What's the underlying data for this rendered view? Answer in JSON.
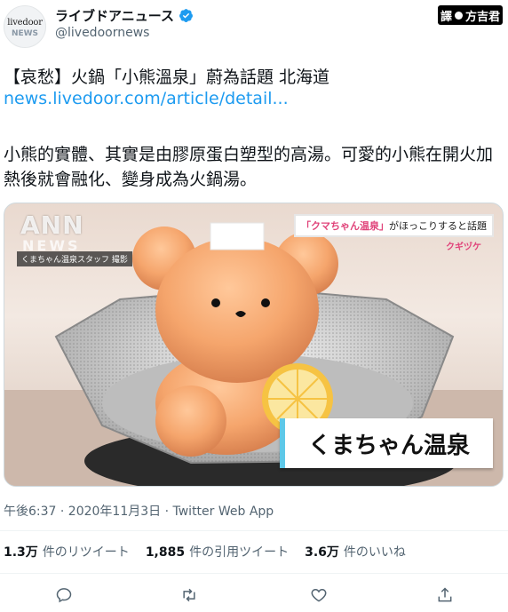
{
  "account": {
    "avatar_line1": "livedoor",
    "avatar_line2": "NEWS",
    "display_name": "ライブドアニュース",
    "handle": "@livedoornews"
  },
  "watermark": {
    "left": "譯",
    "right": "方吉君"
  },
  "tweet": {
    "headline": "【哀愁】火鍋「小熊溫泉」蔚為話題 北海道",
    "link": "news.livedoor.com/article/detail...",
    "body": "小熊的實體、其實是由膠原蛋白塑型的高湯。可愛的小熊在開火加熱後就會融化、變身成為火鍋湯。"
  },
  "media": {
    "logo": "ANN",
    "logo_sub": "NEWS",
    "credit": "くまちゃん温泉スタッフ 撮影",
    "banner_highlight": "「クマちゃん温泉」",
    "banner_rest": "がほっこりすると話題",
    "sub_label": "クギヅケ",
    "caption": "くまちゃん温泉"
  },
  "meta": "午後6:37 · 2020年11月3日 · Twitter Web App",
  "stats": {
    "retweets_count": "1.3万",
    "retweets_label": "件のリツイート",
    "quotes_count": "1,885",
    "quotes_label": "件の引用ツイート",
    "likes_count": "3.6万",
    "likes_label": "件のいいね"
  },
  "colors": {
    "link": "#1d9bf0",
    "verified": "#1d9bf0",
    "muted": "#536471"
  },
  "icons": [
    "verified-icon",
    "reply-icon",
    "retweet-icon",
    "like-icon",
    "share-icon"
  ]
}
